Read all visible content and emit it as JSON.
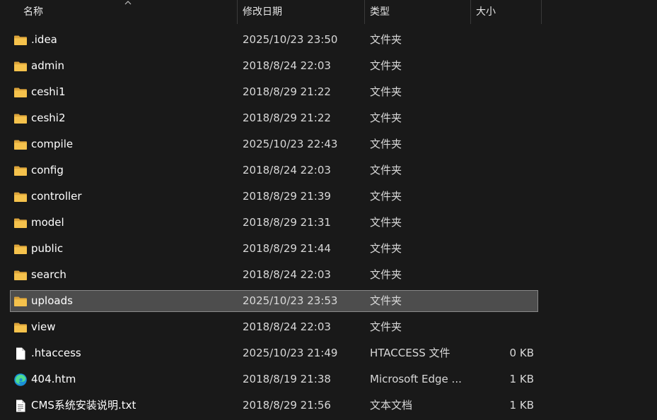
{
  "header": {
    "name": "名称",
    "date": "修改日期",
    "type": "类型",
    "size": "大小"
  },
  "files": [
    {
      "name": ".idea",
      "date": "2025/10/23 23:50",
      "type": "文件夹",
      "size": "",
      "icon": "folder-icon"
    },
    {
      "name": "admin",
      "date": "2018/8/24 22:03",
      "type": "文件夹",
      "size": "",
      "icon": "folder-icon"
    },
    {
      "name": "ceshi1",
      "date": "2018/8/29 21:22",
      "type": "文件夹",
      "size": "",
      "icon": "folder-icon"
    },
    {
      "name": "ceshi2",
      "date": "2018/8/29 21:22",
      "type": "文件夹",
      "size": "",
      "icon": "folder-icon"
    },
    {
      "name": "compile",
      "date": "2025/10/23 22:43",
      "type": "文件夹",
      "size": "",
      "icon": "folder-icon"
    },
    {
      "name": "config",
      "date": "2018/8/24 22:03",
      "type": "文件夹",
      "size": "",
      "icon": "folder-icon"
    },
    {
      "name": "controller",
      "date": "2018/8/29 21:39",
      "type": "文件夹",
      "size": "",
      "icon": "folder-icon"
    },
    {
      "name": "model",
      "date": "2018/8/29 21:31",
      "type": "文件夹",
      "size": "",
      "icon": "folder-icon"
    },
    {
      "name": "public",
      "date": "2018/8/29 21:44",
      "type": "文件夹",
      "size": "",
      "icon": "folder-icon"
    },
    {
      "name": "search",
      "date": "2018/8/24 22:03",
      "type": "文件夹",
      "size": "",
      "icon": "folder-icon"
    },
    {
      "name": "uploads",
      "date": "2025/10/23 23:53",
      "type": "文件夹",
      "size": "",
      "icon": "folder-icon",
      "selected": true
    },
    {
      "name": "view",
      "date": "2018/8/24 22:03",
      "type": "文件夹",
      "size": "",
      "icon": "folder-icon"
    },
    {
      "name": ".htaccess",
      "date": "2025/10/23 21:49",
      "type": "HTACCESS 文件",
      "size": "0 KB",
      "icon": "file-icon"
    },
    {
      "name": "404.htm",
      "date": "2018/8/19 21:38",
      "type": "Microsoft Edge ...",
      "size": "1 KB",
      "icon": "edge-icon"
    },
    {
      "name": "CMS系统安装说明.txt",
      "date": "2018/8/29 21:56",
      "type": "文本文档",
      "size": "1 KB",
      "icon": "text-file-icon"
    }
  ],
  "colors": {
    "background": "#191919",
    "selected_row": "#4d4d4d",
    "folder": "#f5c24c"
  }
}
